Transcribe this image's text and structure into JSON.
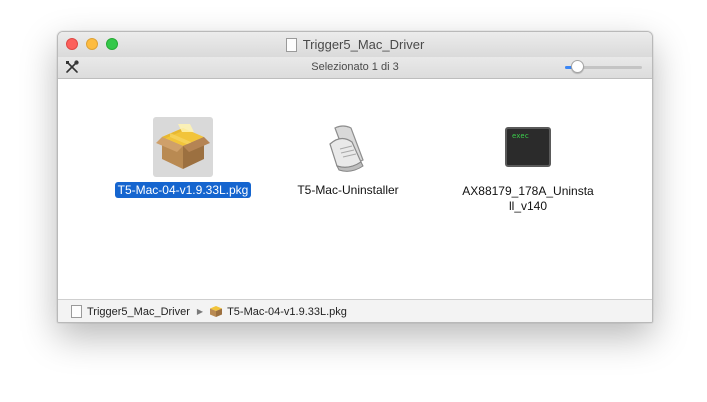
{
  "window": {
    "title": "Trigger5_Mac_Driver",
    "title_icon": "folder-doc-icon",
    "controls": [
      "close",
      "minimize",
      "zoom"
    ],
    "colors": {
      "close": "#fc605c",
      "minimize": "#fdbc40",
      "zoom": "#34c84a"
    }
  },
  "toolbar": {
    "tools_icon": "tools-icon",
    "status": "Selezionato 1 di 3",
    "icon_size_level": 0.15,
    "accent": "#3b87f6"
  },
  "files": [
    {
      "name": "T5-Mac-04-v1.9.33L.pkg",
      "icon": "package-icon",
      "selected": true
    },
    {
      "name": "T5-Mac-Uninstaller",
      "icon": "script-icon",
      "selected": false
    },
    {
      "name": "AX88179_178A_Uninstall_v140",
      "icon": "exec-icon",
      "icon_text": "exec",
      "selected": false
    }
  ],
  "pathbar": {
    "folder": "Trigger5_Mac_Driver",
    "file": "T5-Mac-04-v1.9.33L.pkg",
    "selection_color": "#1565cf"
  }
}
